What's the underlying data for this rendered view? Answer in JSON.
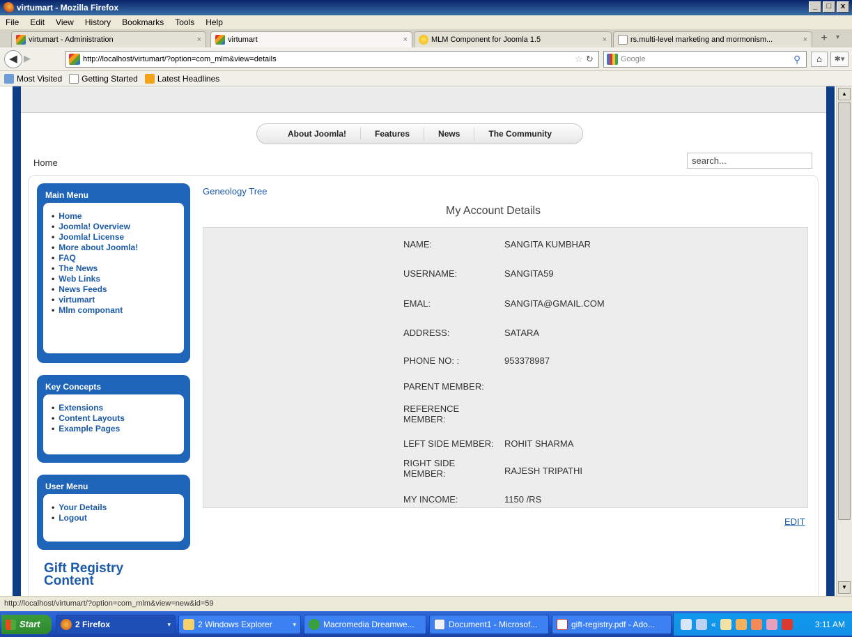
{
  "window": {
    "title": "virtumart - Mozilla Firefox",
    "buttons": [
      "_",
      "□",
      "x"
    ]
  },
  "menubar": [
    "File",
    "Edit",
    "View",
    "History",
    "Bookmarks",
    "Tools",
    "Help"
  ],
  "tabs": [
    {
      "label": "virtumart - Administration",
      "icon": "joomla-icon"
    },
    {
      "label": "virtumart",
      "icon": "joomla-icon",
      "active": true
    },
    {
      "label": "MLM Component for Joomla 1.5",
      "icon": "page-icon"
    },
    {
      "label": "rs.multi-level marketing and mormonism...",
      "icon": "page-icon"
    }
  ],
  "tab_close": "×",
  "new_tab": "+",
  "address": {
    "url": "http://localhost/virtumart/?option=com_mlm&view=details"
  },
  "search_engine": {
    "placeholder": "Google"
  },
  "bookmarks": [
    "Most Visited",
    "Getting Started",
    "Latest Headlines"
  ],
  "site": {
    "nav": [
      "About Joomla!",
      "Features",
      "News",
      "The Community"
    ],
    "breadcrumb": "Home",
    "search_placeholder": "search..."
  },
  "modules": {
    "main_menu": {
      "title": "Main Menu",
      "items": [
        "Home",
        "Joomla! Overview",
        "Joomla! License",
        "More about Joomla!",
        "FAQ",
        "The News",
        "Web Links",
        "News Feeds",
        "virtumart",
        "Mlm componant"
      ]
    },
    "key_concepts": {
      "title": "Key Concepts",
      "items": [
        "Extensions",
        "Content Layouts",
        "Example Pages"
      ]
    },
    "user_menu": {
      "title": "User Menu",
      "items": [
        "Your Details",
        "Logout"
      ]
    },
    "gift_registry": {
      "title_line1": "Gift Registry",
      "title_line2": "Content"
    }
  },
  "content": {
    "geneology_link": "Geneology Tree",
    "heading": "My Account Details",
    "details": [
      {
        "label": "NAME:",
        "value": "SANGITA KUMBHAR"
      },
      {
        "label": "USERNAME:",
        "value": "SANGITA59"
      },
      {
        "label": "EMAL:",
        "value": "SANGITA@GMAIL.COM"
      },
      {
        "label": "ADDRESS:",
        "value": "SATARA"
      },
      {
        "label": "PHONE NO: :",
        "value": "953378987"
      },
      {
        "label": "PARENT MEMBER:",
        "value": ""
      },
      {
        "label": "REFERENCE MEMBER:",
        "value": ""
      },
      {
        "label": "LEFT SIDE MEMBER:",
        "value": "ROHIT SHARMA"
      },
      {
        "label": "RIGHT SIDE MEMBER:",
        "value": "RAJESH TRIPATHI"
      },
      {
        "label": "MY INCOME:",
        "value": "1150 /RS"
      }
    ],
    "edit_label": "EDIT"
  },
  "status_text": "http://localhost/virtumart/?option=com_mlm&view=new&id=59",
  "taskbar": {
    "start_label": "Start",
    "buttons": [
      "2 Firefox",
      "2 Windows Explorer",
      "Macromedia Dreamwe...",
      "Document1 - Microsof...",
      "gift-registry.pdf - Ado..."
    ],
    "tray_chevron": "«",
    "clock": "3:11 AM"
  },
  "colors": {
    "brand_blue": "#1e64b8",
    "link_blue": "#1b5aa8",
    "frame_navy": "#0c3e86"
  }
}
